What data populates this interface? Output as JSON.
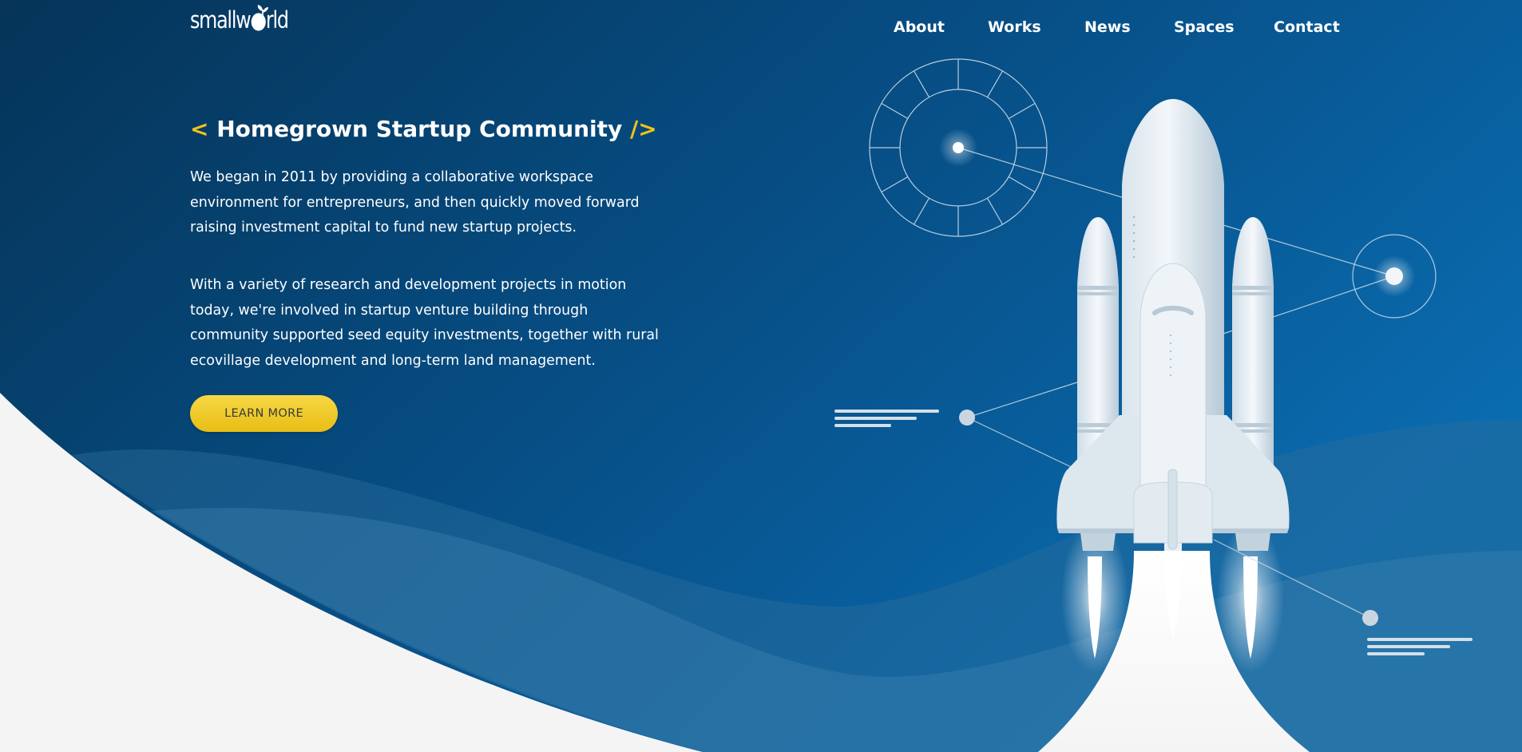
{
  "brand": {
    "logo_text": "smallw●rld"
  },
  "nav": {
    "items": [
      "About",
      "Works",
      "News",
      "Spaces",
      "Contact"
    ]
  },
  "hero": {
    "headline_open": "<",
    "headline": "Homegrown Startup Community",
    "headline_close": "/>",
    "paragraph1": "We began in 2011 by providing a collaborative workspace environment for entrepreneurs, and then quickly moved forward raising investment capital to fund new startup projects.",
    "paragraph2": "With a variety of research and development projects in motion today, we're involved in startup venture building through community supported seed equity investments, together with rural ecovillage development and long-term land management.",
    "cta_label": "LEARN MORE"
  },
  "colors": {
    "hero_dark": "#073a63",
    "hero_light": "#0a6cb0",
    "accent_yellow": "#f3c21a",
    "page_bg": "#f4f4f4",
    "rocket_white": "#e8eef2"
  }
}
